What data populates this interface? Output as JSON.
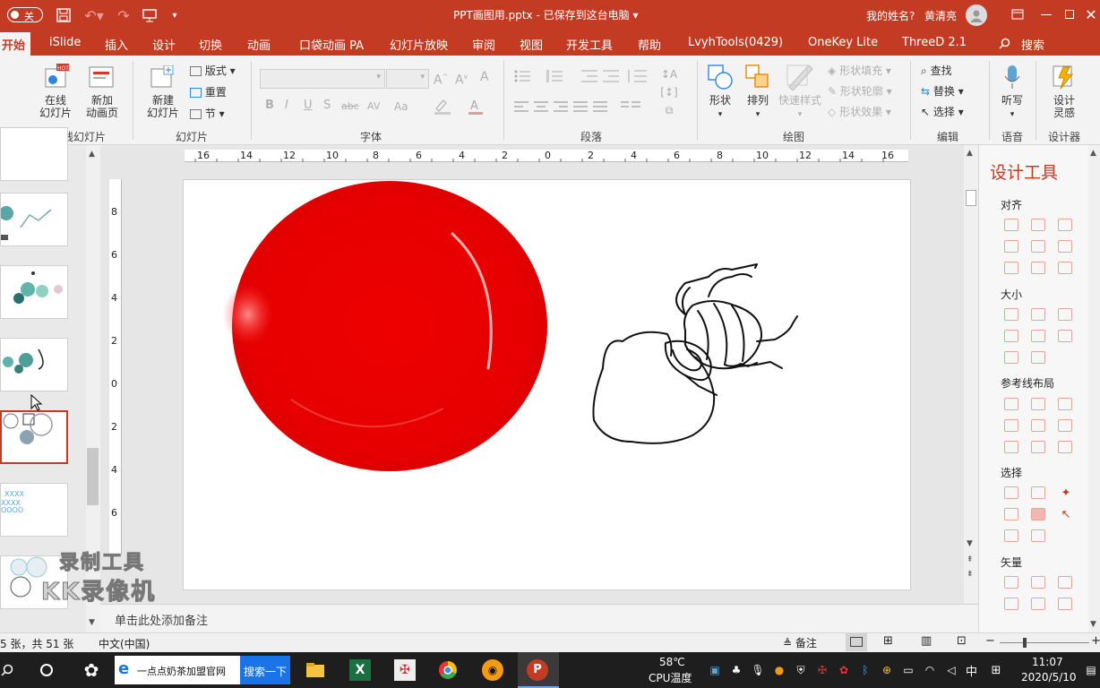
{
  "colors": {
    "accent": "#c33b23",
    "slide_circle": "#ee0000"
  },
  "titlebar": {
    "autosave_label": "关",
    "doc_title": "PPT画图用.pptx - 已保存到这台电脑",
    "user_prompt": "我的姓名?",
    "user_name": "黄清亮"
  },
  "tabs": [
    "开始",
    "iSlide",
    "插入",
    "设计",
    "切换",
    "动画",
    "口袋动画 PA",
    "幻灯片放映",
    "审阅",
    "视图",
    "开发工具",
    "帮助",
    "LvyhTools(0429)",
    "OneKey Lite",
    "ThreeD 2.1"
  ],
  "search_label": "搜索",
  "ribbon": {
    "online_slide": "在线\n幻灯片",
    "new_anim_page": "新加\n动画页",
    "group_online": "在线幻灯片",
    "new_slide": "新建\n幻灯片",
    "layout": "版式",
    "reset": "重置",
    "section": "节",
    "group_slides": "幻灯片",
    "group_font": "字体",
    "group_paragraph": "段落",
    "shapes": "形状",
    "arrange": "排列",
    "quick_styles": "快速样式",
    "shape_fill": "形状填充",
    "shape_outline": "形状轮廓",
    "shape_effects": "形状效果",
    "group_drawing": "绘图",
    "find": "查找",
    "replace": "替换",
    "select": "选择",
    "group_editing": "编辑",
    "dictate": "听写",
    "group_voice": "语音",
    "designer": "设计\n灵感",
    "group_designer": "设计器",
    "font_format": [
      "B",
      "I",
      "U",
      "S",
      "abc",
      "AV",
      "Aa"
    ]
  },
  "ruler_top": [
    "16",
    "14",
    "12",
    "10",
    "8",
    "6",
    "4",
    "2",
    "0",
    "2",
    "4",
    "6",
    "8",
    "10",
    "12",
    "14",
    "16"
  ],
  "ruler_left": [
    "8",
    "6",
    "4",
    "2",
    "0",
    "2",
    "4",
    "6"
  ],
  "notes_placeholder": "单击此处添加备注",
  "watermark": [
    "录制工具",
    "KK录像机"
  ],
  "side_panel": {
    "title": "设计工具",
    "sections": [
      "对齐",
      "大小",
      "参考线布局",
      "选择",
      "矢量"
    ]
  },
  "status": {
    "slide_pos": "5 张，共 51 张",
    "language": "中文(中国)",
    "notes_btn": "备注"
  },
  "taskbar": {
    "search_text": "一点点奶茶加盟官网",
    "search_button": "搜索一下",
    "temp": "58℃",
    "temp_label": "CPU温度",
    "ime": "中",
    "time": "11:07",
    "date": "2020/5/10"
  }
}
